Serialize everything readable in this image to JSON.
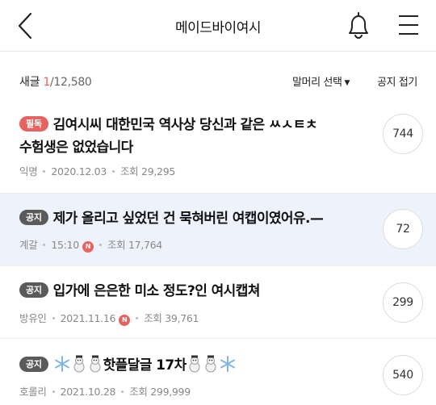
{
  "header": {
    "title": "메이드바이여시",
    "back_icon": "chevron-left-icon",
    "bell_icon": "bell-icon",
    "menu_icon": "hamburger-menu-icon"
  },
  "subbar": {
    "prefix": "새글",
    "current": "1",
    "total": "/12,580",
    "filter_label": "말머리 선택",
    "fold_label": "공지 접기"
  },
  "posts": [
    {
      "badge": "필독",
      "title_line1": "김여시씨 대한민국 역사상 당신과 같은 ㅆㅅㅌㅊ",
      "title_line2": "수험생은 없었습니다",
      "author": "익명",
      "date": "2020.12.03",
      "views": "조회 29,295",
      "comments": "744"
    },
    {
      "badge": "공지",
      "title": "제가 올리고 싶었던 건 묵혀버린 여캡이였어유.—",
      "author": "계갈",
      "date": "15:10",
      "new_mark": "N",
      "views": "조회 17,764",
      "comments": "72"
    },
    {
      "badge": "공지",
      "title": "입가에 은은한 미소 정도?인 여시캡쳐",
      "author": "방유인",
      "date": "2021.11.16",
      "new_mark": "N",
      "views": "조회 39,761",
      "comments": "299"
    },
    {
      "badge": "공지",
      "title": "핫플달글 17차",
      "author": "호롤리",
      "date": "2021.10.28",
      "views": "조회 299,999",
      "comments": "540"
    }
  ],
  "colors": {
    "accent": "#e8625f",
    "notice_badge": "#5a5a5a",
    "highlight_row": "#eef3fb"
  }
}
